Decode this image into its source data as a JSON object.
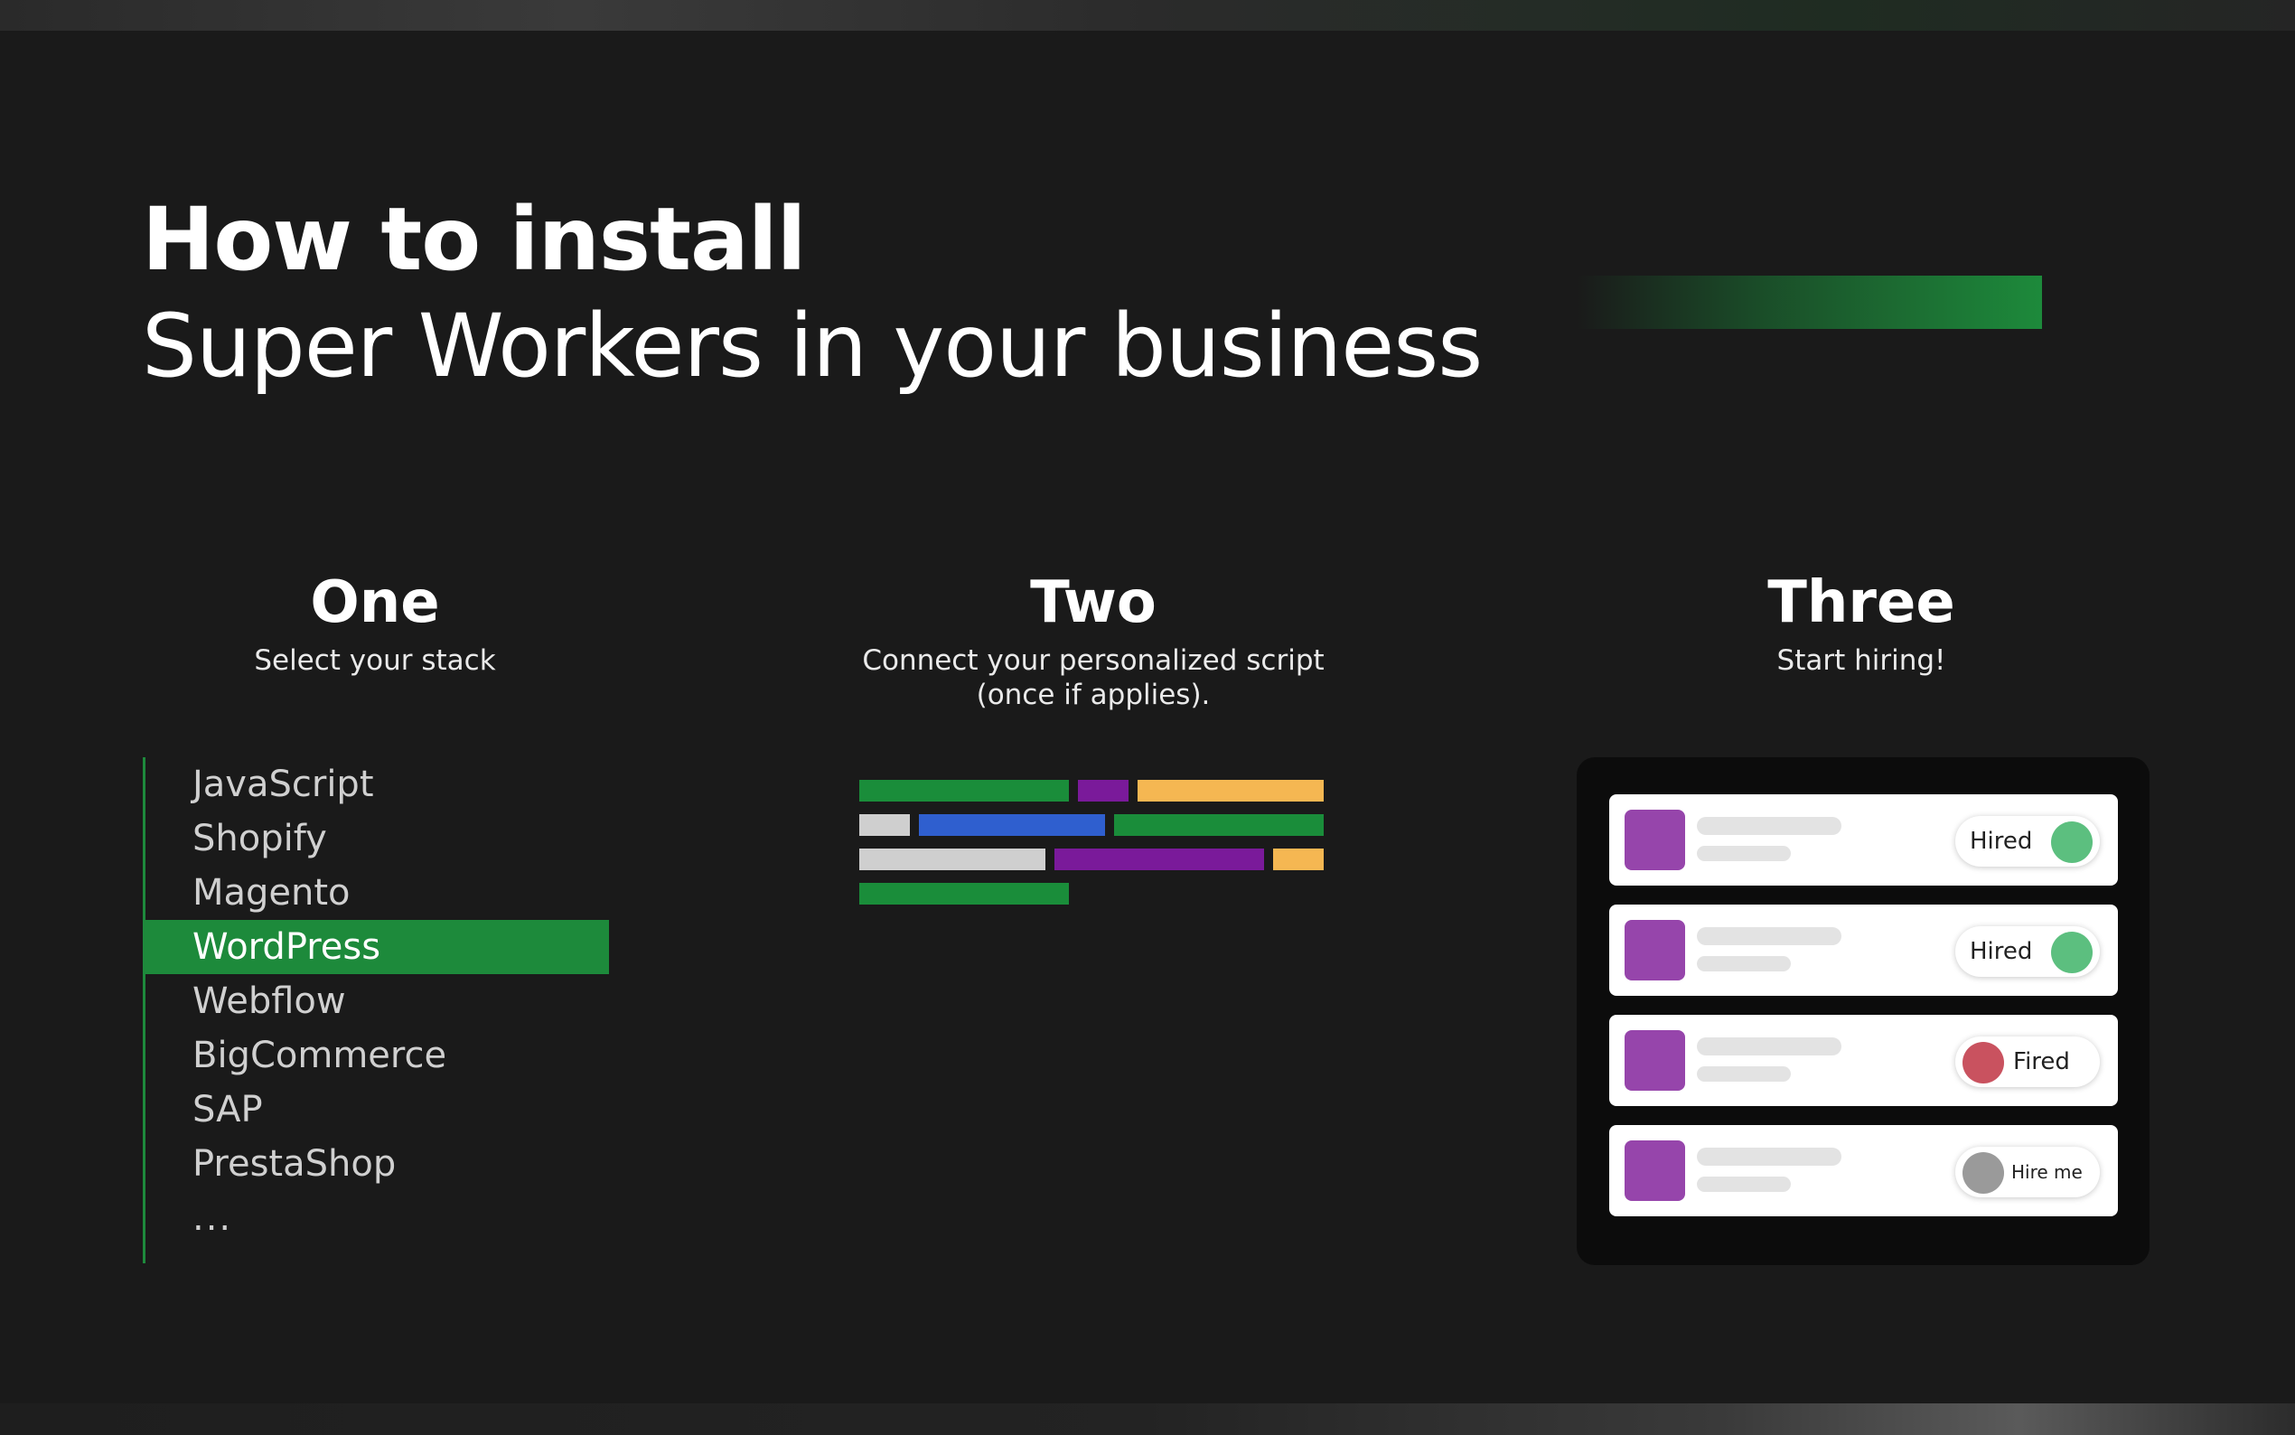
{
  "hero": {
    "title": "How to install",
    "subtitle": "Super Workers in your business"
  },
  "steps": {
    "one": {
      "title": "One",
      "desc": "Select your stack"
    },
    "two": {
      "title": "Two",
      "desc_line1": "Connect your personalized script",
      "desc_line2": "(once if applies)."
    },
    "three": {
      "title": "Three",
      "desc": "Start hiring!"
    }
  },
  "stack": {
    "items": [
      "JavaScript",
      "Shopify",
      "Magento",
      "WordPress",
      "Webflow",
      "BigCommerce",
      "SAP",
      "PrestaShop",
      "..."
    ],
    "selected": "WordPress"
  },
  "workers": [
    {
      "status": "Hired"
    },
    {
      "status": "Hired"
    },
    {
      "status": "Fired"
    },
    {
      "status": "Hire me"
    }
  ],
  "colors": {
    "background": "#1a1a1a",
    "accent_green": "#1d8a3b",
    "code_green": "#1a8d3a",
    "code_purple": "#7a1a9a",
    "code_orange": "#f5b752",
    "code_blue": "#2f5fcf",
    "code_gray": "#cfcfcf",
    "avatar_purple": "#9645ab",
    "hired_dot": "#5cbf7f",
    "fired_dot": "#c9525f",
    "hire_me_dot": "#9a9a9a"
  }
}
